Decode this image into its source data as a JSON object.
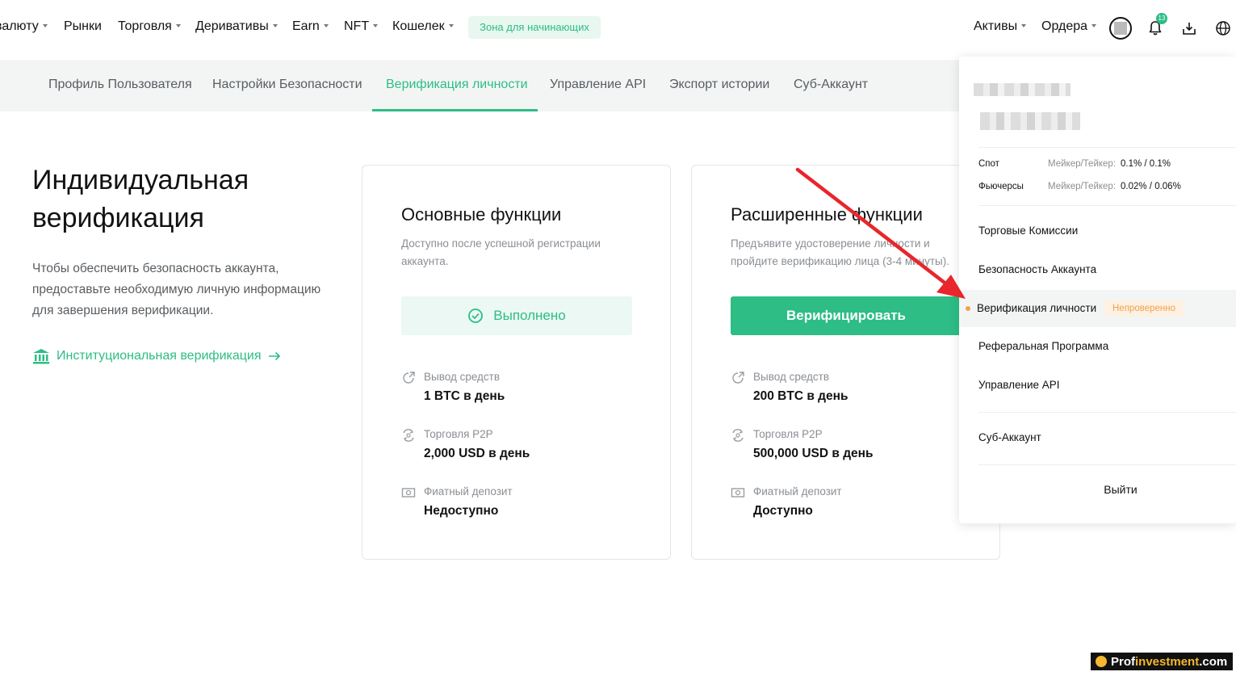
{
  "topnav": {
    "items": [
      {
        "label": "валюту",
        "caret": true
      },
      {
        "label": "Рынки",
        "caret": false
      },
      {
        "label": "Торговля",
        "caret": true
      },
      {
        "label": "Деривативы",
        "caret": true
      },
      {
        "label": "Earn",
        "caret": true
      },
      {
        "label": "NFT",
        "caret": true
      },
      {
        "label": "Кошелек",
        "caret": true
      }
    ],
    "beginner_zone": "Зона для начинающих",
    "assets": "Активы",
    "orders": "Ордера",
    "notification_count": "13",
    "icons": [
      "avatar",
      "bell-icon",
      "download-icon",
      "globe-icon"
    ]
  },
  "subnav": {
    "tabs": [
      {
        "label": "Профиль Пользователя",
        "active": false
      },
      {
        "label": "Настройки Безопасности",
        "active": false
      },
      {
        "label": "Верификация личности",
        "active": true
      },
      {
        "label": "Управление API",
        "active": false
      },
      {
        "label": "Экспорт истории",
        "active": false
      },
      {
        "label": "Суб-Аккаунт",
        "active": false
      }
    ]
  },
  "hero": {
    "title": "Индивидуальная верификация",
    "description": "Чтобы обеспечить безопасность аккаунта, предоставьте необходимую личную информацию для завершения верификации.",
    "institutional_link": "Институциональная верификация"
  },
  "cards": {
    "basic": {
      "title": "Основные функции",
      "subtitle": "Доступно после успешной регистрации аккаунта.",
      "button": "Выполнено",
      "features": [
        {
          "label": "Вывод средств",
          "value": "1 BTC в день",
          "icon": "withdraw-icon"
        },
        {
          "label": "Торговля P2P",
          "value": "2,000 USD в день",
          "icon": "p2p-icon"
        },
        {
          "label": "Фиатный депозит",
          "value": "Недоступно",
          "icon": "fiat-icon"
        }
      ]
    },
    "advanced": {
      "title": "Расширенные функции",
      "subtitle": "Предъявите удостоверение личности и пройдите верификацию лица (3-4 минуты).",
      "button": "Верифицировать",
      "features": [
        {
          "label": "Вывод средств",
          "value": "200 BTC в день",
          "icon": "withdraw-icon"
        },
        {
          "label": "Торговля P2P",
          "value": "500,000 USD в день",
          "icon": "p2p-icon"
        },
        {
          "label": "Фиатный депозит",
          "value": "Доступно",
          "icon": "fiat-icon"
        }
      ]
    }
  },
  "dropdown": {
    "fees": [
      {
        "label": "Спот",
        "maker_taker": "Мейкер/Тейкер:",
        "value": "0.1% / 0.1%"
      },
      {
        "label": "Фьючерсы",
        "maker_taker": "Мейкер/Тейкер:",
        "value": "0.02% / 0.06%"
      }
    ],
    "items": {
      "trading_fees": "Торговые Комиссии",
      "account_security": "Безопасность Аккаунта",
      "identity_verification": "Верификация личности",
      "unverified_badge": "Непроверенно",
      "referral": "Реферальная Программа",
      "api": "Управление API",
      "sub_account": "Суб-Аккаунт",
      "logout": "Выйти"
    }
  },
  "annotation": {
    "arrow_color": "#e8262b"
  },
  "watermark": {
    "prefix": "Prof",
    "highlight": "investment",
    "suffix": ".com"
  },
  "colors": {
    "accent": "#2dbd85",
    "warning": "#f0a14b"
  }
}
